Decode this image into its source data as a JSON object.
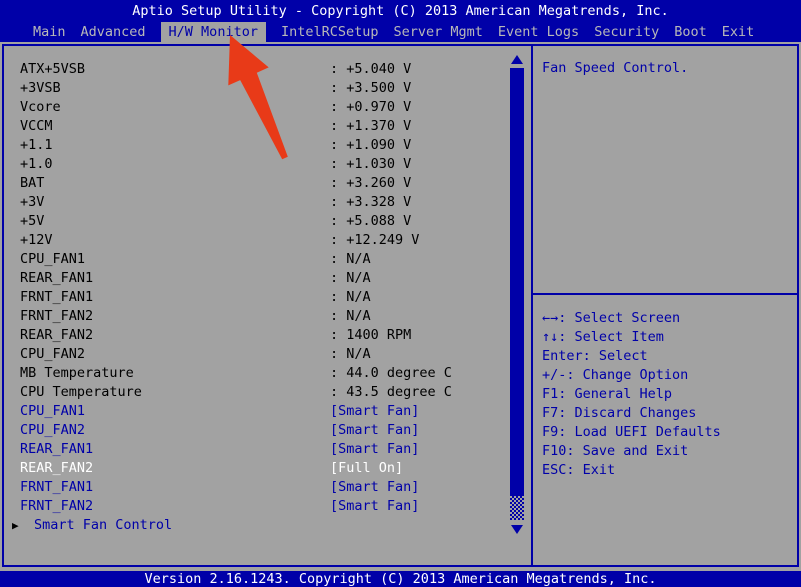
{
  "colors": {
    "blue": "#0000a8",
    "background_gray": "#a2a2a2",
    "inactive_tab_text": "#b8b8b8",
    "selected_item_text": "#ffffff",
    "reading_text": "#000000",
    "annotation_arrow_red": "#e83a18"
  },
  "title_bar": {
    "text": "Aptio Setup Utility - Copyright (C) 2013 American Megatrends, Inc."
  },
  "menu_bar": {
    "active_tab": "H/W Monitor",
    "tabs": [
      {
        "label": "Main",
        "active": false
      },
      {
        "label": "Advanced",
        "active": false
      },
      {
        "label": "H/W Monitor",
        "active": true
      },
      {
        "label": "IntelRCSetup",
        "active": false
      },
      {
        "label": "Server Mgmt",
        "active": false
      },
      {
        "label": "Event Logs",
        "active": false
      },
      {
        "label": "Security",
        "active": false
      },
      {
        "label": "Boot",
        "active": false
      },
      {
        "label": "Exit",
        "active": false
      }
    ]
  },
  "hw_monitor": {
    "readings": [
      {
        "label": "ATX+5VSB",
        "value": ": +5.040 V"
      },
      {
        "label": "+3VSB",
        "value": ": +3.500 V"
      },
      {
        "label": "Vcore",
        "value": ": +0.970 V"
      },
      {
        "label": "VCCM",
        "value": ": +1.370 V"
      },
      {
        "label": "+1.1",
        "value": ": +1.090 V"
      },
      {
        "label": "+1.0",
        "value": ": +1.030 V"
      },
      {
        "label": "BAT",
        "value": ": +3.260 V"
      },
      {
        "label": "+3V",
        "value": ": +3.328 V"
      },
      {
        "label": "+5V",
        "value": ": +5.088 V"
      },
      {
        "label": "+12V",
        "value": ": +12.249 V"
      },
      {
        "label": "CPU_FAN1",
        "value": ": N/A"
      },
      {
        "label": "REAR_FAN1",
        "value": ": N/A"
      },
      {
        "label": "FRNT_FAN1",
        "value": ": N/A"
      },
      {
        "label": "FRNT_FAN2",
        "value": ": N/A"
      },
      {
        "label": "REAR_FAN2",
        "value": ": 1400 RPM"
      },
      {
        "label": "CPU_FAN2",
        "value": ": N/A"
      },
      {
        "label": "MB Temperature",
        "value": ": 44.0 degree C"
      },
      {
        "label": "CPU Temperature",
        "value": ": 43.5 degree C"
      }
    ],
    "settings": [
      {
        "label": "CPU_FAN1",
        "value": "[Smart Fan]",
        "selected": false
      },
      {
        "label": "CPU_FAN2",
        "value": "[Smart Fan]",
        "selected": false
      },
      {
        "label": "REAR_FAN1",
        "value": "[Smart Fan]",
        "selected": false
      },
      {
        "label": "REAR_FAN2",
        "value": "[Full On]",
        "selected": true
      },
      {
        "label": "FRNT_FAN1",
        "value": "[Smart Fan]",
        "selected": false
      },
      {
        "label": "FRNT_FAN2",
        "value": "[Smart Fan]",
        "selected": false
      }
    ],
    "submenu": {
      "marker": "▶",
      "label": "Smart Fan Control"
    }
  },
  "help_panel": {
    "description": "Fan Speed Control.",
    "keys": [
      "←→: Select Screen",
      "↑↓: Select Item",
      "Enter: Select",
      "+/-: Change Option",
      "F1: General Help",
      "F7: Discard Changes",
      "F9: Load UEFI Defaults",
      "F10: Save and Exit",
      "ESC: Exit"
    ]
  },
  "footer": {
    "text": "Version 2.16.1243. Copyright (C) 2013 American Megatrends, Inc."
  }
}
